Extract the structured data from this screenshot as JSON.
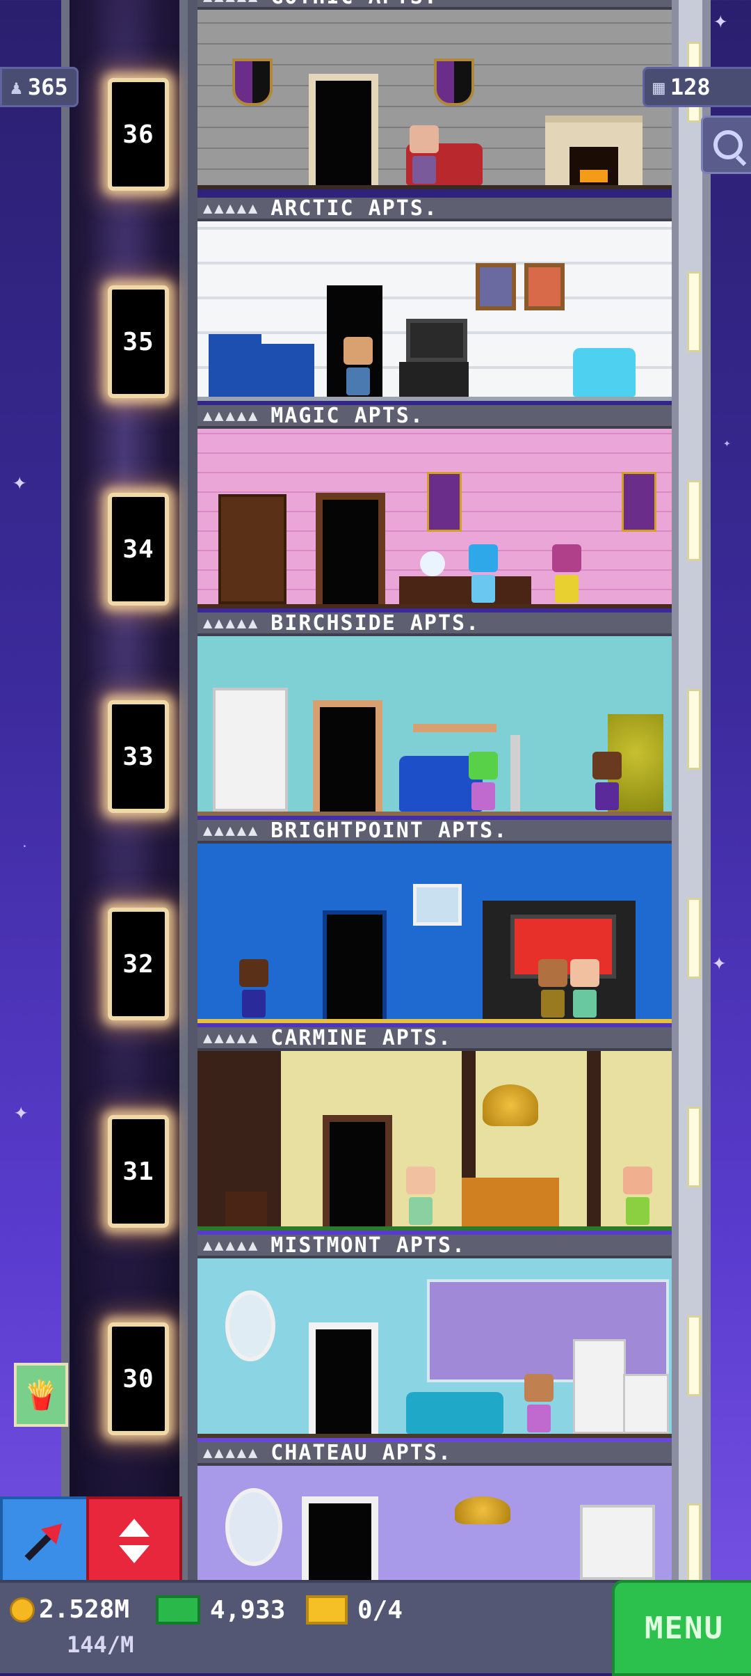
{
  "hud": {
    "population": "365",
    "floors_count": "128"
  },
  "elevator": {
    "floors": [
      "36",
      "35",
      "34",
      "33",
      "32",
      "31",
      "30"
    ]
  },
  "floors": [
    {
      "name": "GOTHIC APTS.",
      "people": "▲▲▲▲▲"
    },
    {
      "name": "ARCTIC APTS.",
      "people": "▲▲▲▲▲"
    },
    {
      "name": "MAGIC APTS.",
      "people": "▲▲▲▲▲"
    },
    {
      "name": "BIRCHSIDE APTS.",
      "people": "▲▲▲▲▲"
    },
    {
      "name": "BRIGHTPOINT APTS.",
      "people": "▲▲▲▲▲"
    },
    {
      "name": "CARMINE APTS.",
      "people": "▲▲▲▲▲"
    },
    {
      "name": "MISTMONT APTS.",
      "people": "▲▲▲▲▲"
    },
    {
      "name": "CHATEAU APTS.",
      "people": "▲▲▲▲▲"
    }
  ],
  "bottom": {
    "coins": "2.528M",
    "coin_rate": "144/M",
    "bux": "4,933",
    "tickets": "0/4",
    "menu_label": "MENU"
  },
  "colors": {
    "sky": "#3b2a9a",
    "menu": "#2cc04c",
    "elevator_button": "#e8263c",
    "bitizen_button": "#3a8ee8"
  },
  "icons": [
    "person-icon",
    "floors-icon",
    "search-icon",
    "arrow-icon",
    "up-down-icon",
    "coin-icon",
    "bux-icon",
    "ticket-icon",
    "fries-icon"
  ]
}
